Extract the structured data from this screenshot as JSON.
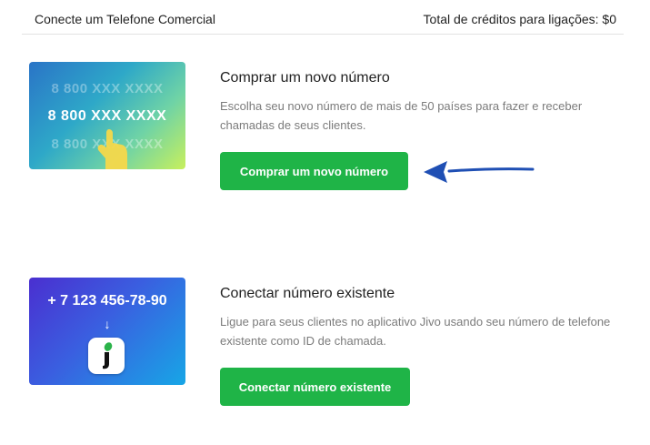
{
  "header": {
    "title": "Conecte um Telefone Comercial",
    "credits": "Total de créditos para ligações: $0"
  },
  "buy": {
    "card_numbers": [
      "8 800 XXX XXXX",
      "8 800 XXX XXXX",
      "8 800 XXX XXXX"
    ],
    "title": "Comprar um novo número",
    "description": "Escolha seu novo número de mais de 50 países para fazer e receber chamadas de seus clientes.",
    "button_label": "Comprar um novo número"
  },
  "connect": {
    "card_number": "+ 7 123 456-78-90",
    "card_arrow": "↓",
    "title": "Conectar número existente",
    "description": "Ligue para seus clientes no aplicativo Jivo usando seu número de telefone existente como ID de chamada.",
    "button_label": "Conectar número existente"
  },
  "colors": {
    "button_green": "#1fb447",
    "annotation_arrow": "#1f4fb4"
  },
  "icons": {
    "hand": "pointing-hand-icon",
    "jivo": "jivo-logo-icon",
    "arrow": "arrow-left-annotation"
  }
}
